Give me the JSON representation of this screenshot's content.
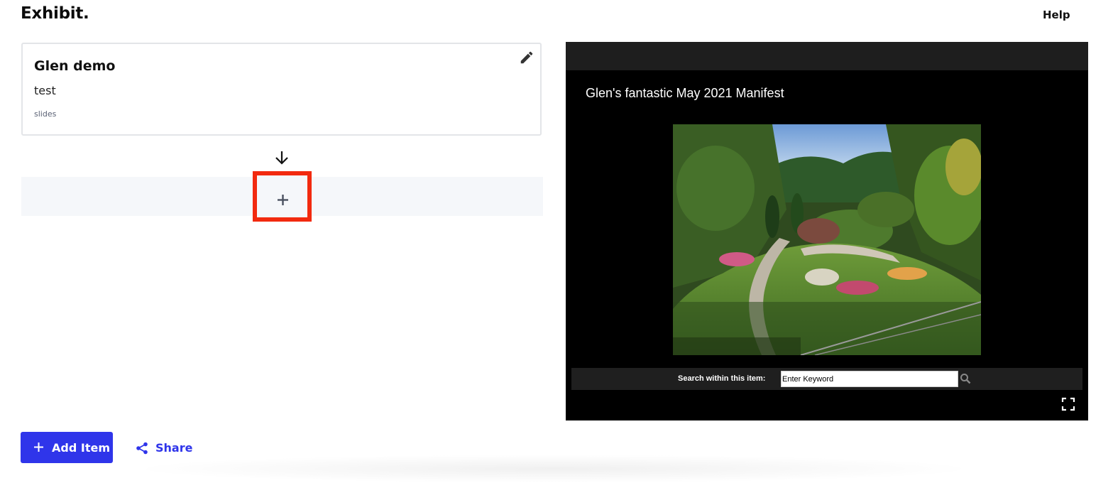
{
  "header": {
    "logo": "Exhibit.",
    "help_label": "Help"
  },
  "item": {
    "title": "Glen demo",
    "description": "test",
    "type": "slides"
  },
  "actions": {
    "add_item_label": "Add Item",
    "share_label": "Share"
  },
  "viewer": {
    "title": "Glen's fantastic May 2021 Manifest",
    "search_label": "Search within this item:",
    "search_placeholder": "Enter Keyword"
  },
  "colors": {
    "accent": "#2f35ea",
    "highlight": "#f22a0f",
    "viewer_bg": "#000000"
  },
  "icons": [
    "pencil-icon",
    "arrow-down-icon",
    "plus-icon",
    "share-icon",
    "search-icon",
    "fullscreen-icon"
  ]
}
